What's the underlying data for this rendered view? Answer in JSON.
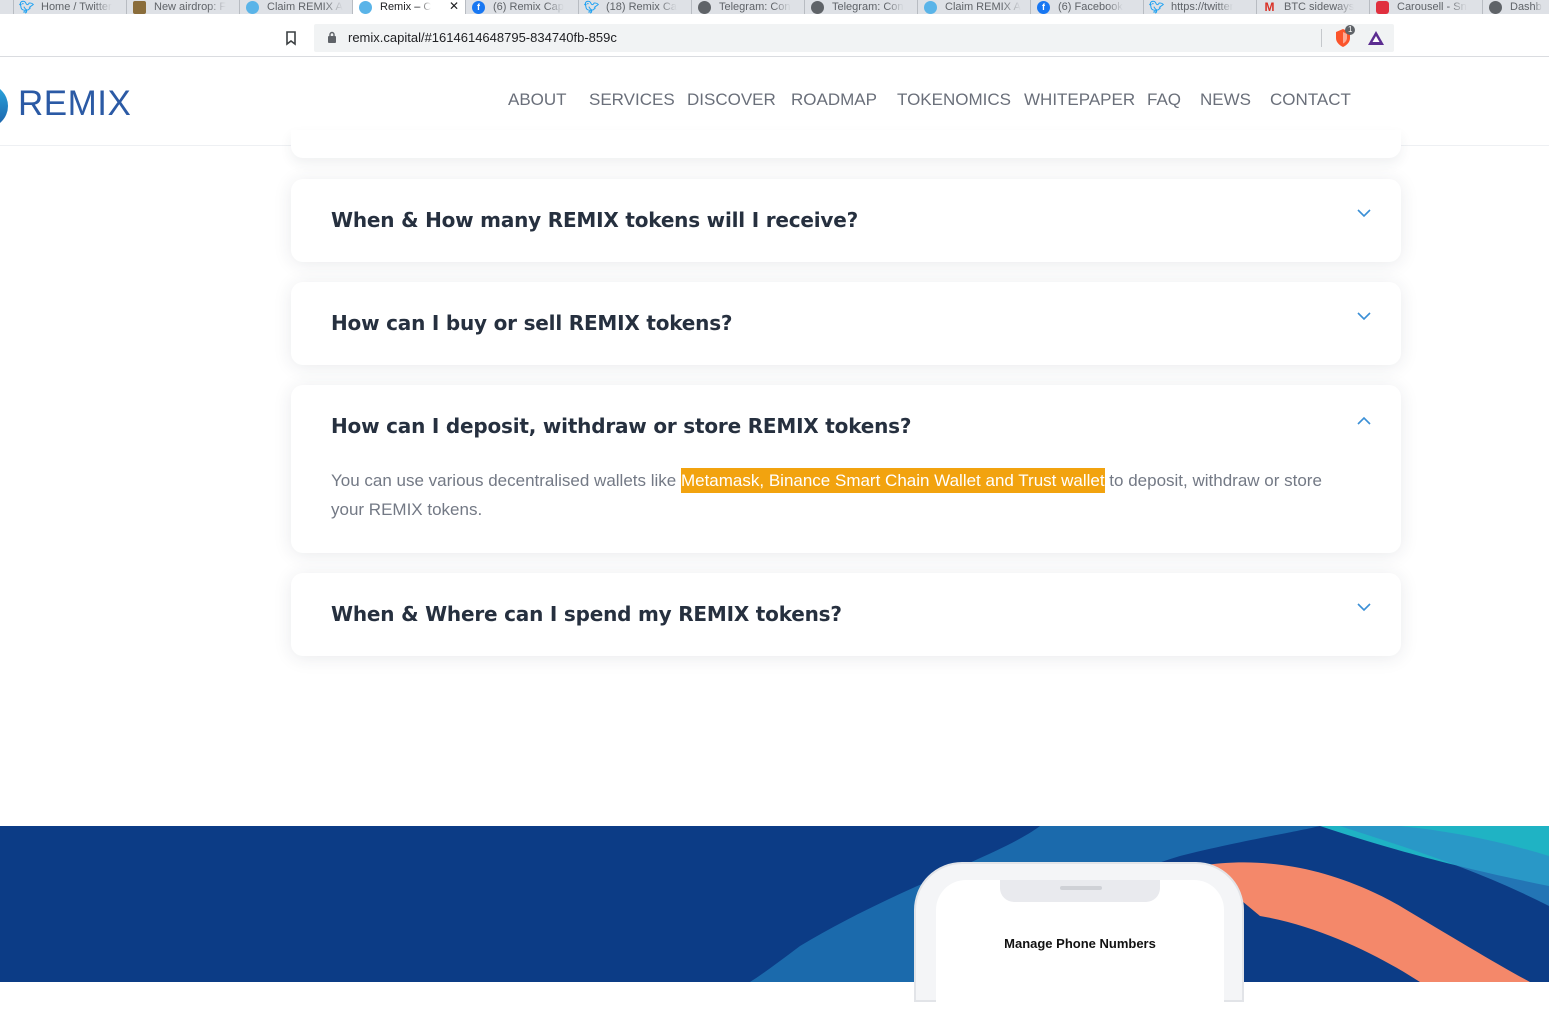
{
  "browser": {
    "tabs": [
      {
        "title": "Home / Twitter",
        "icon": "twitter-icon",
        "color": "#1da1f2",
        "active": false
      },
      {
        "title": "New airdrop: F",
        "icon": "airdrop-icon",
        "color": "#8a6d3b",
        "active": false
      },
      {
        "title": "Claim REMIX A",
        "icon": "remix-icon",
        "color": "#5ab4e8",
        "active": false
      },
      {
        "title": "Remix – C",
        "icon": "remix-icon",
        "color": "#5ab4e8",
        "active": true
      },
      {
        "title": "(6) Remix Cap",
        "icon": "facebook-icon",
        "color": "#1877f2",
        "active": false
      },
      {
        "title": "(18) Remix Ca",
        "icon": "twitter-icon",
        "color": "#1da1f2",
        "active": false
      },
      {
        "title": "Telegram: Con",
        "icon": "globe-icon",
        "color": "#5f6368",
        "active": false
      },
      {
        "title": "Telegram: Con",
        "icon": "globe-icon",
        "color": "#5f6368",
        "active": false
      },
      {
        "title": "Claim REMIX A",
        "icon": "remix-icon",
        "color": "#5ab4e8",
        "active": false
      },
      {
        "title": "(6) Facebook",
        "icon": "facebook-icon",
        "color": "#1877f2",
        "active": false
      },
      {
        "title": "https://twitter",
        "icon": "twitter-icon",
        "color": "#1da1f2",
        "active": false
      },
      {
        "title": "BTC sideways",
        "icon": "gmail-icon",
        "color": "#d93025",
        "active": false
      },
      {
        "title": "Carousell - Sn",
        "icon": "carousell-icon",
        "color": "#e0303e",
        "active": false
      },
      {
        "title": "Dashb",
        "icon": "globe-icon",
        "color": "#5f6368",
        "active": false
      }
    ],
    "close_glyph": "✕",
    "url": "remix.capital/#1614614648795-834740fb-859c",
    "shield_badge": "1"
  },
  "header": {
    "logo_text": "REMIX",
    "nav": [
      "ABOUT",
      "SERVICES",
      "DISCOVER",
      "ROADMAP",
      "TOKENOMICS",
      "WHITEPAPER",
      "FAQ",
      "NEWS",
      "CONTACT"
    ]
  },
  "faq": [
    {
      "question": "When & How many REMIX tokens will I receive?",
      "expanded": false
    },
    {
      "question": "How can I buy or sell REMIX tokens?",
      "expanded": false
    },
    {
      "question": "How can I deposit, withdraw or store REMIX tokens?",
      "expanded": true,
      "answer_before": "You can use various decentralised wallets like ",
      "answer_highlight": "Metamask, Binance Smart Chain Wallet and Trust wallet",
      "answer_after": " to deposit, withdraw or store your REMIX tokens."
    },
    {
      "question": "When & Where can I spend my REMIX tokens?",
      "expanded": false
    }
  ],
  "footer": {
    "phone_title": "Manage Phone Numbers"
  },
  "colors": {
    "brand": "#2b5aa5",
    "highlight": "#f2a30f",
    "band": "#0c3c86",
    "chevron": "#3a8fd6"
  }
}
